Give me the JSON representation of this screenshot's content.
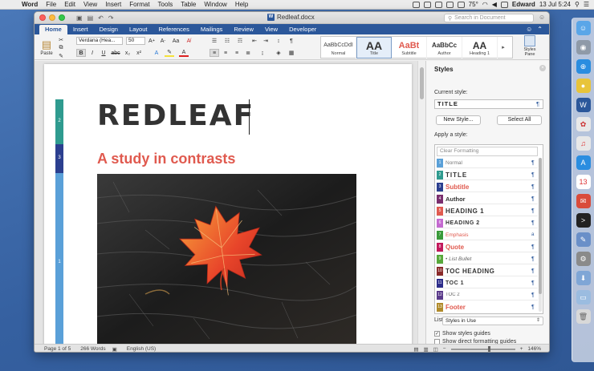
{
  "menubar": {
    "app": "Word",
    "menus": [
      "File",
      "Edit",
      "View",
      "Insert",
      "Format",
      "Tools",
      "Table",
      "Window",
      "Help"
    ],
    "battery": "75°",
    "user": "Edward",
    "datetime": "13 Jul  5:24"
  },
  "window": {
    "title": "Redleaf.docx",
    "search_placeholder": "Search in Document"
  },
  "ribbon": {
    "tabs": [
      "Home",
      "Insert",
      "Design",
      "Layout",
      "References",
      "Mailings",
      "Review",
      "View",
      "Developer"
    ],
    "active_tab": "Home",
    "paste_label": "Paste",
    "font_name": "Verdana (Hea...",
    "font_size": "50",
    "styles_gallery": [
      {
        "preview": "AaBbCcDdI",
        "label": "Normal"
      },
      {
        "preview": "AA",
        "label": "Title"
      },
      {
        "preview": "AaBt",
        "label": "Subtitle"
      },
      {
        "preview": "AaBbCc",
        "label": "Author"
      },
      {
        "preview": "AA",
        "label": "Heading 1"
      }
    ],
    "styles_pane_label": "Styles Pane"
  },
  "document": {
    "title": "REDLEAF",
    "subtitle": "A study in contrasts",
    "ruler_numbers": [
      "2",
      "3",
      "1"
    ]
  },
  "panel": {
    "title": "Styles",
    "current_style_label": "Current style:",
    "current_style_value": "TITLE",
    "new_style": "New Style...",
    "select_all": "Select All",
    "apply_label": "Apply a style:",
    "clear_formatting": "Clear Formatting",
    "styles": [
      {
        "name": "Normal",
        "num": "1",
        "color": "#5aa0d8",
        "mark": "¶"
      },
      {
        "name": "TITLE",
        "num": "2",
        "color": "#2f9b8f",
        "mark": "¶"
      },
      {
        "name": "Subtitle",
        "num": "3",
        "color": "#2b3f8f",
        "mark": "¶"
      },
      {
        "name": "Author",
        "num": "4",
        "color": "#7a2e6e",
        "mark": "¶"
      },
      {
        "name": "HEADING 1",
        "num": "5",
        "color": "#e05a4f",
        "mark": "¶"
      },
      {
        "name": "HEADING 2",
        "num": "6",
        "color": "#c46ad0",
        "mark": "¶"
      },
      {
        "name": "Emphasis",
        "num": "7",
        "color": "#3a9a3a",
        "mark": "a"
      },
      {
        "name": "Quote",
        "num": "8",
        "color": "#c2185b",
        "mark": "¶"
      },
      {
        "name": "• List Bullet",
        "num": "9",
        "color": "#57a83a",
        "mark": "¶"
      },
      {
        "name": "TOC HEADING",
        "num": "10",
        "color": "#8a2a2a",
        "mark": "¶"
      },
      {
        "name": "TOC 1",
        "num": "11",
        "color": "#2c2c8a",
        "mark": "¶"
      },
      {
        "name": "TOC 2",
        "num": "12",
        "color": "#5a3a8a",
        "mark": "¶"
      },
      {
        "name": "Footer",
        "num": "13",
        "color": "#b08a2a",
        "mark": "¶"
      }
    ],
    "list_label": "List:",
    "list_value": "Styles in Use",
    "show_guides": "Show styles guides",
    "show_direct": "Show direct formatting guides",
    "show_guides_checked": true,
    "show_direct_checked": false
  },
  "status": {
    "page": "Page 1 of 5",
    "words": "266 Words",
    "language": "English (US)",
    "zoom": "146%"
  },
  "colors": {
    "accent": "#2b579a",
    "title_text": "#333333",
    "subtitle_text": "#e05a4f"
  }
}
